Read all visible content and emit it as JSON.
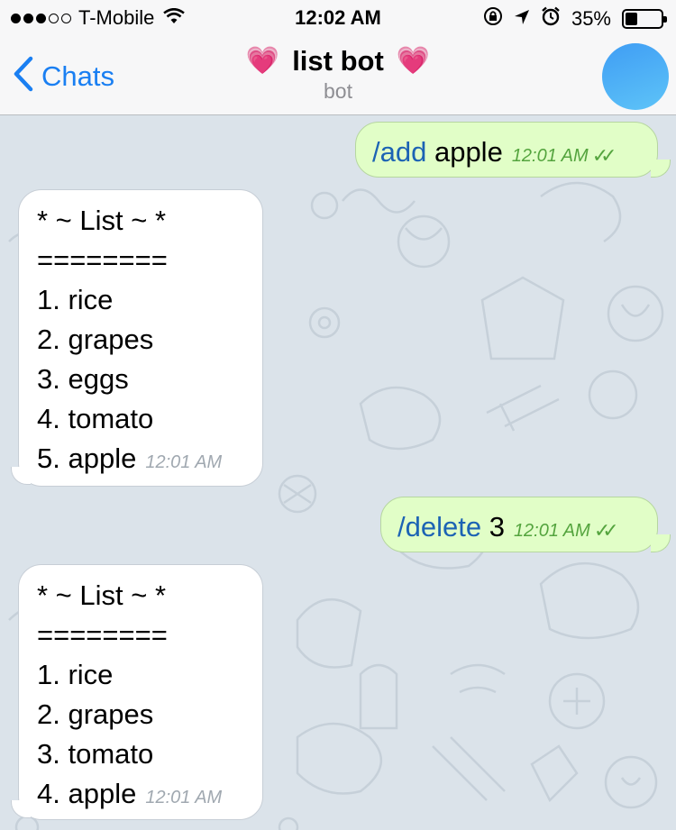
{
  "status_bar": {
    "carrier": "T-Mobile",
    "time": "12:02 AM",
    "battery_text": "35%",
    "battery_level": 0.35,
    "icons": [
      "signal-dots",
      "wifi-icon",
      "rotation-lock-icon",
      "location-arrow-icon",
      "alarm-icon",
      "battery-icon"
    ]
  },
  "nav": {
    "back_label": "Chats",
    "title": "list bot",
    "title_emoji": "💗",
    "subtitle": "bot"
  },
  "messages": [
    {
      "direction": "out",
      "command": "/add",
      "text": " apple",
      "time": "12:01 AM",
      "read": true
    },
    {
      "direction": "in",
      "lines": [
        "* ~ List ~ *",
        "========",
        "1. rice",
        "2. grapes",
        "3. eggs",
        "4. tomato",
        "5. apple"
      ],
      "time": "12:01 AM"
    },
    {
      "direction": "out",
      "command": "/delete",
      "text": " 3",
      "time": "12:01 AM",
      "read": true
    },
    {
      "direction": "in",
      "lines": [
        "* ~ List ~ *",
        "========",
        "1. rice",
        "2. grapes",
        "3. tomato",
        "4. apple"
      ],
      "time": "12:01 AM"
    }
  ],
  "colors": {
    "accent": "#1a7ff2",
    "outgoing_bubble": "#e1fec7",
    "incoming_bubble": "#ffffff",
    "chat_background": "#dbe3ea",
    "read_ticks": "#54a43e",
    "command_link": "#1c63b4"
  }
}
